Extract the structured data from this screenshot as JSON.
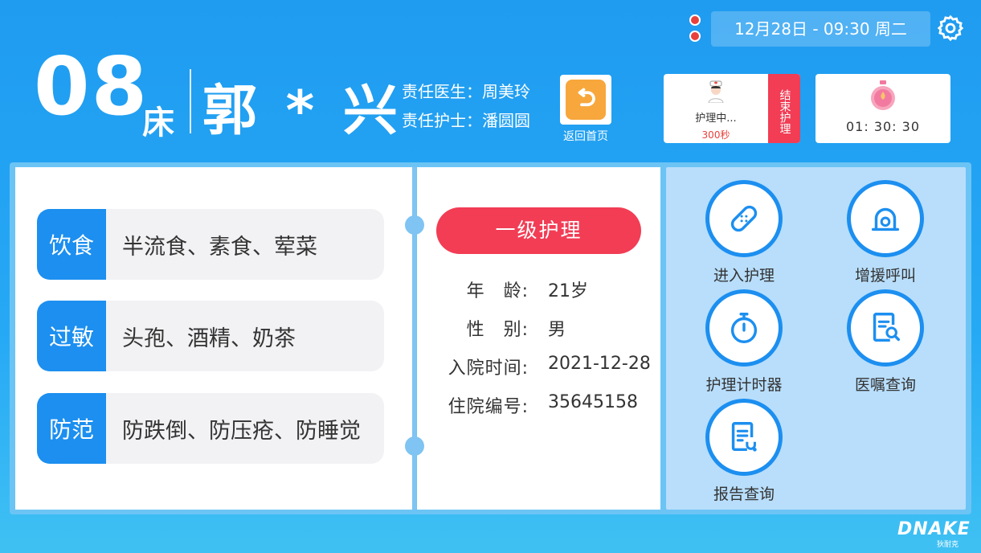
{
  "status_bar": {
    "datetime": "12月28日 - 09:30   周二"
  },
  "header": {
    "bed_number": "08",
    "bed_unit": "床",
    "patient_name": "郭 * 兴",
    "doctor": "责任医生：周美玲",
    "nurse": "责任护士：潘圆圆",
    "home_label": "返回首页"
  },
  "care_card": {
    "status": "护理中...",
    "seconds": "300秒",
    "end_label": "结束护理"
  },
  "timer_card": {
    "time": "01: 30: 30"
  },
  "info_rows": [
    {
      "tag": "饮食",
      "value": "半流食、素食、荤菜"
    },
    {
      "tag": "过敏",
      "value": "头孢、酒精、奶茶"
    },
    {
      "tag": "防范",
      "value": "防跌倒、防压疮、防睡觉"
    }
  ],
  "patient": {
    "level": "一级护理",
    "fields": [
      {
        "key": "年　龄:",
        "value": "21岁"
      },
      {
        "key": "性　别:",
        "value": "男"
      },
      {
        "key": "入院时间:",
        "value": "2021-12-28"
      },
      {
        "key": "住院编号:",
        "value": "35645158"
      }
    ]
  },
  "actions": [
    {
      "label": "进入护理",
      "icon": "bandage-icon"
    },
    {
      "label": "增援呼叫",
      "icon": "alarm-icon"
    },
    {
      "label": "护理计时器",
      "icon": "stopwatch-icon"
    },
    {
      "label": "医嘱查询",
      "icon": "document-search-icon"
    },
    {
      "label": "报告查询",
      "icon": "report-icon"
    }
  ],
  "brand": {
    "name": "DNAKE",
    "sub": "狄耐克"
  },
  "colors": {
    "primary": "#1c8ff0",
    "accent_red": "#f23d55",
    "home_orange": "#f7a73c"
  }
}
